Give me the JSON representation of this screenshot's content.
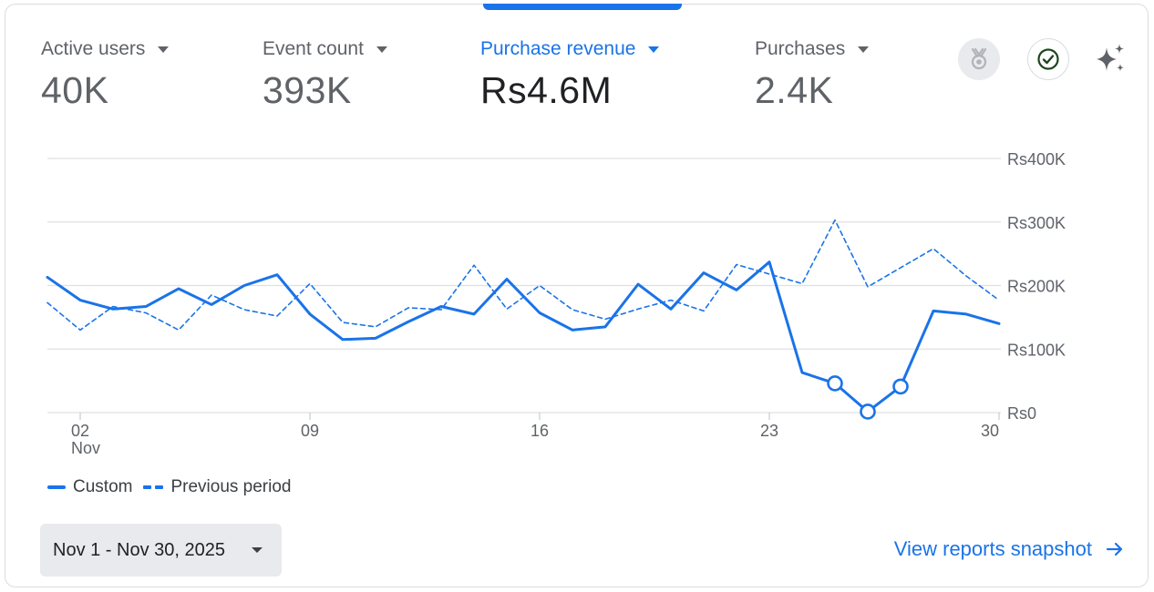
{
  "metrics": [
    {
      "label": "Active users",
      "value": "40K",
      "active": false
    },
    {
      "label": "Event count",
      "value": "393K",
      "active": false
    },
    {
      "label": "Purchase revenue",
      "value": "Rs4.6M",
      "active": true
    },
    {
      "label": "Purchases",
      "value": "2.4K",
      "active": false
    }
  ],
  "icons": {
    "award": "award-badge-icon",
    "check": "check-circle-icon",
    "sparkle": "sparkle-icon"
  },
  "colors": {
    "accent": "#1a73e8",
    "text": "#202124",
    "muted": "#5f6368",
    "grid": "#e0e0e0"
  },
  "chart_data": {
    "type": "line",
    "x": [
      1,
      2,
      3,
      4,
      5,
      6,
      7,
      8,
      9,
      10,
      11,
      12,
      13,
      14,
      15,
      16,
      17,
      18,
      19,
      20,
      21,
      22,
      23,
      24,
      25,
      26,
      27,
      28,
      29,
      30
    ],
    "x_ticks": [
      {
        "day": 2,
        "label": "02",
        "sublabel": "Nov"
      },
      {
        "day": 9,
        "label": "09",
        "sublabel": ""
      },
      {
        "day": 16,
        "label": "16",
        "sublabel": ""
      },
      {
        "day": 23,
        "label": "23",
        "sublabel": ""
      },
      {
        "day": 30,
        "label": "30",
        "sublabel": ""
      }
    ],
    "y_ticks": [
      {
        "value": 0,
        "label": "Rs0"
      },
      {
        "value": 100000,
        "label": "Rs100K"
      },
      {
        "value": 200000,
        "label": "Rs200K"
      },
      {
        "value": 300000,
        "label": "Rs300K"
      },
      {
        "value": 400000,
        "label": "Rs400K"
      }
    ],
    "ylim": [
      0,
      400000
    ],
    "xlim": [
      1,
      30
    ],
    "series": [
      {
        "name": "Custom",
        "style": "solid",
        "values": [
          213000,
          177000,
          163000,
          167000,
          195000,
          170000,
          200000,
          217000,
          155000,
          115000,
          117000,
          143000,
          167000,
          155000,
          210000,
          157000,
          130000,
          135000,
          202000,
          163000,
          220000,
          193000,
          237000,
          63000,
          46000,
          1500,
          41000,
          160000,
          155000,
          140000
        ],
        "markers": [
          25,
          26,
          27
        ]
      },
      {
        "name": "Previous period",
        "style": "dashed",
        "values": [
          173000,
          130000,
          167000,
          157000,
          130000,
          185000,
          162000,
          152000,
          203000,
          142000,
          135000,
          165000,
          162000,
          232000,
          163000,
          200000,
          162000,
          147000,
          163000,
          177000,
          160000,
          233000,
          218000,
          203000,
          303000,
          198000,
          228000,
          258000,
          215000,
          177000
        ]
      }
    ],
    "grid": true,
    "legend_position": "bottom-left"
  },
  "footer": {
    "date_range": "Nov 1 - Nov 30, 2025",
    "view_link": "View reports snapshot"
  }
}
